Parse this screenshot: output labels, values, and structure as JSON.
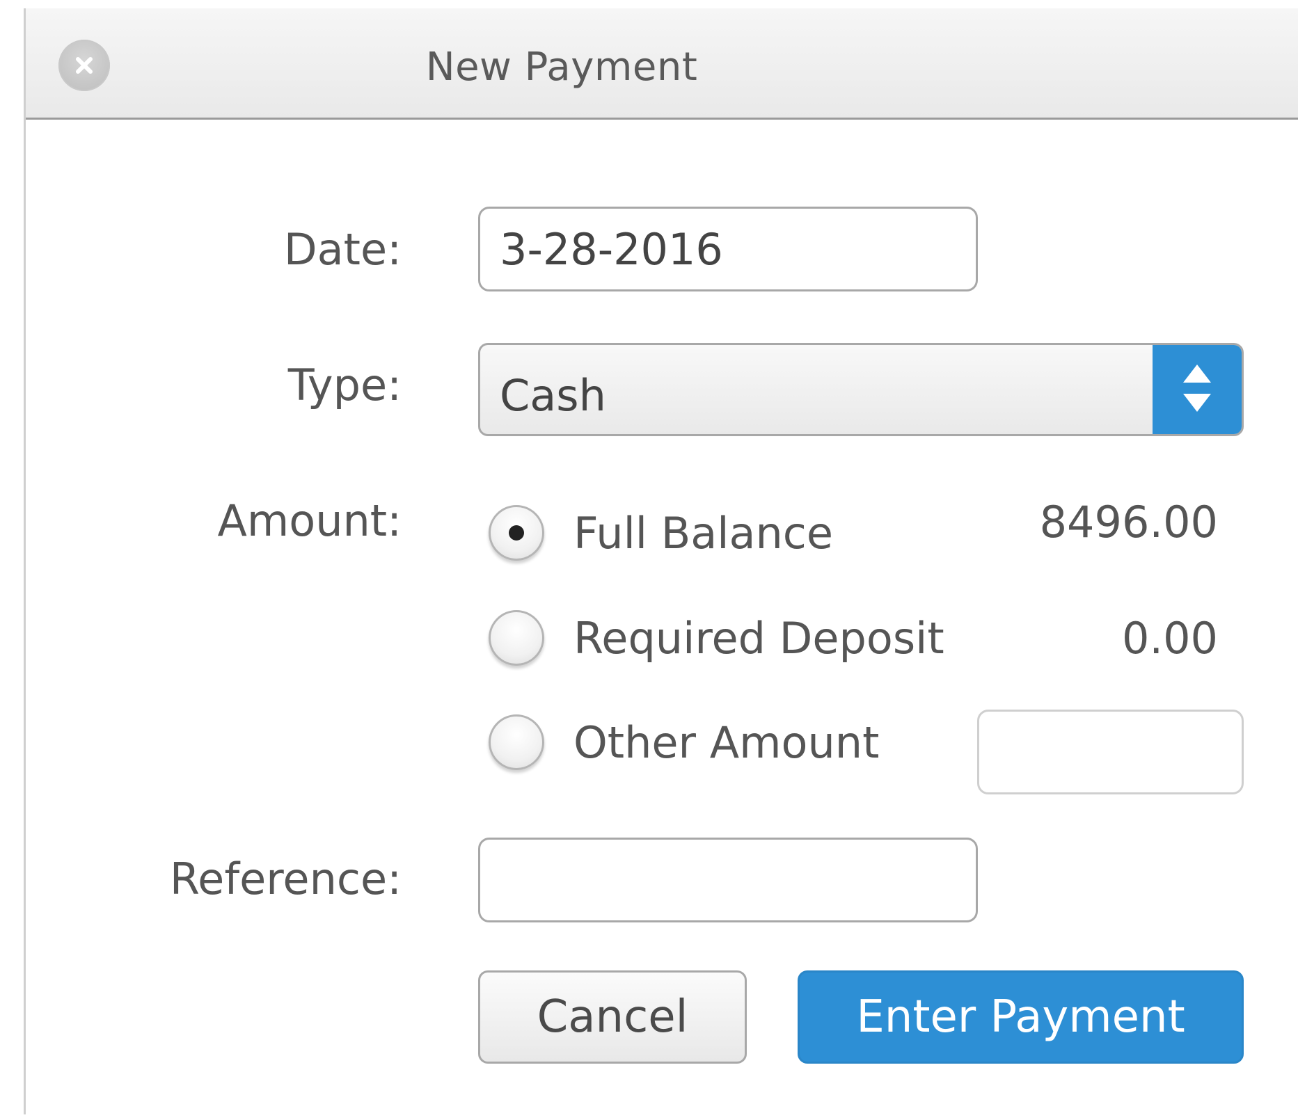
{
  "window": {
    "title": "New Payment",
    "close_icon": "close-icon"
  },
  "form": {
    "date_label": "Date:",
    "date_value": "3-28-2016",
    "type_label": "Type:",
    "type_value": "Cash",
    "type_arrow_icon": "up-down-arrows-icon",
    "amount_label": "Amount:",
    "reference_label": "Reference:",
    "reference_value": ""
  },
  "amount_options": [
    {
      "label": "Full Balance",
      "value": "8496.00",
      "selected": true
    },
    {
      "label": "Required Deposit",
      "value": "0.00",
      "selected": false
    },
    {
      "label": "Other Amount",
      "value": "",
      "selected": false
    }
  ],
  "buttons": {
    "cancel": "Cancel",
    "submit": "Enter Payment"
  },
  "colors": {
    "accent": "#2d8fd5",
    "text": "#555555",
    "border": "#a8a8a8"
  }
}
